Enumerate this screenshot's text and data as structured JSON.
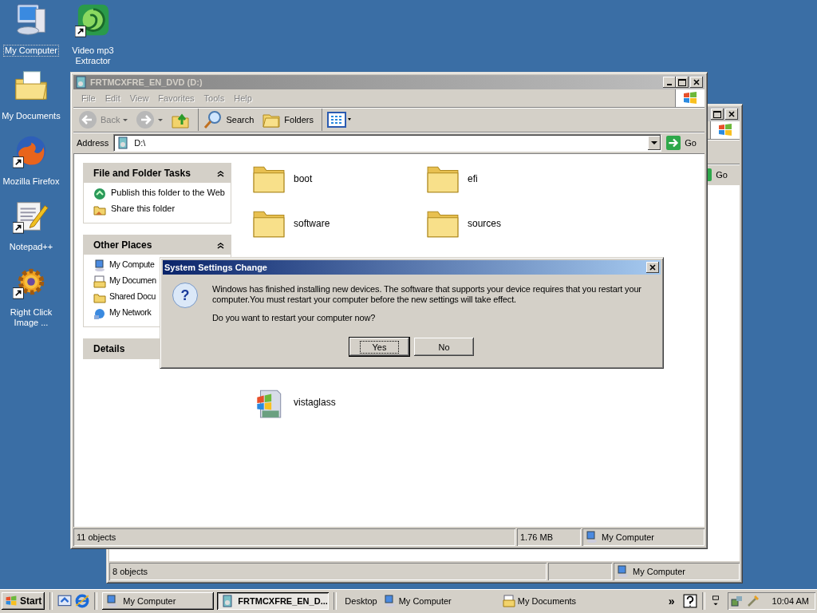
{
  "desktop_icons": [
    {
      "label": "My Computer",
      "kind": "computer",
      "shortcut": false,
      "selected": true
    },
    {
      "label": "My Documents",
      "kind": "documents",
      "shortcut": false,
      "selected": false
    },
    {
      "label": "Mozilla Firefox",
      "kind": "firefox",
      "shortcut": true,
      "selected": false
    },
    {
      "label": "Notepad++",
      "kind": "notepad",
      "shortcut": true,
      "selected": false
    },
    {
      "label": "Right Click Image ...",
      "kind": "gear",
      "shortcut": true,
      "selected": false
    },
    {
      "label": "Video mp3 Extractor",
      "kind": "swirl",
      "shortcut": true,
      "selected": false
    }
  ],
  "back_window": {
    "go_label": "Go",
    "status_bar": {
      "objects": "8 objects",
      "location": "My Computer"
    }
  },
  "window": {
    "title": "FRTMCXFRE_EN_DVD (D:)",
    "menu": [
      "File",
      "Edit",
      "View",
      "Favorites",
      "Tools",
      "Help"
    ],
    "toolbar": [
      {
        "kind": "back",
        "label": "Back",
        "disabled": true
      },
      {
        "kind": "forward",
        "disabled": true
      },
      {
        "kind": "up"
      },
      {
        "kind": "search",
        "label": "Search"
      },
      {
        "kind": "folders",
        "label": "Folders"
      },
      {
        "kind": "views"
      }
    ],
    "address": {
      "label": "Address",
      "value": "D:\\",
      "go_label": "Go"
    },
    "panels": [
      {
        "title": "File and Folder Tasks",
        "expanded": true,
        "items": [
          {
            "kind": "globe",
            "label": "Publish this folder to the Web"
          },
          {
            "kind": "share",
            "label": "Share this folder"
          }
        ]
      },
      {
        "title": "Other Places",
        "expanded": true,
        "items": [
          {
            "kind": "computer",
            "label": "My Compute"
          },
          {
            "kind": "documents",
            "label": "My Documen"
          },
          {
            "kind": "folder",
            "label": "Shared Docu"
          },
          {
            "kind": "network",
            "label": "My Network"
          }
        ]
      },
      {
        "title": "Details",
        "expanded": false
      }
    ],
    "files": [
      {
        "name": "boot",
        "kind": "folder"
      },
      {
        "name": "efi",
        "kind": "folder"
      },
      {
        "name": "software",
        "kind": "folder"
      },
      {
        "name": "sources",
        "kind": "folder"
      },
      {
        "name": "vistaglass",
        "kind": "installer"
      }
    ],
    "status_bar": [
      "11 objects",
      "1.76 MB",
      "My Computer"
    ]
  },
  "dialog": {
    "title": "System Settings Change",
    "icon_text": "?",
    "message": "Windows has finished installing new devices. The software that supports your device requires that you restart your computer.You must restart your computer before the new settings will take effect.",
    "question": "Do you want to restart your computer now?",
    "buttons": [
      {
        "label": "Yes",
        "default": true
      },
      {
        "label": "No",
        "default": false
      }
    ]
  },
  "taskbar": {
    "start": "Start",
    "tasks": [
      {
        "label": "My Computer",
        "selected": false
      },
      {
        "label": "FRTMCXFRE_EN_D...",
        "selected": true
      }
    ],
    "toolbar_title": "Desktop",
    "links": [
      {
        "label": "My Computer",
        "kind": "computer"
      },
      {
        "label": "My Documents",
        "kind": "documents"
      }
    ],
    "more": "»",
    "clock": "10:04 AM"
  }
}
